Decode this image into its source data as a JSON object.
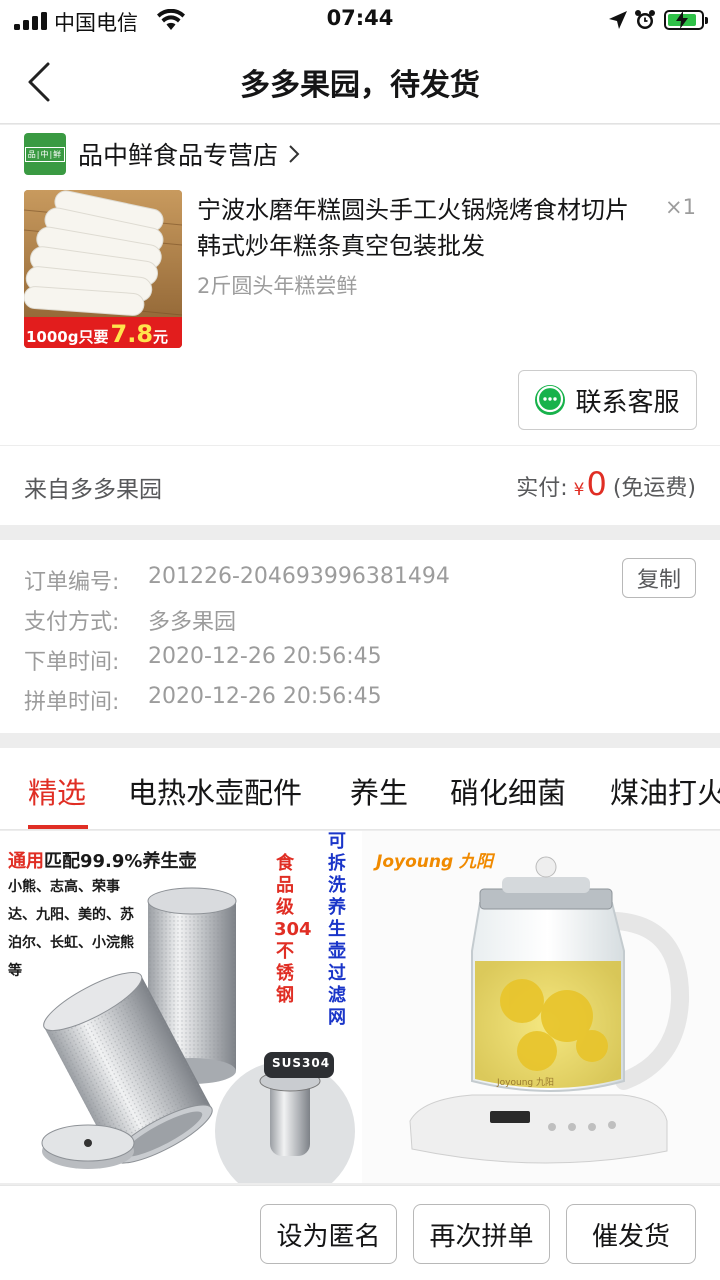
{
  "status_bar": {
    "carrier": "中国电信",
    "time": "07:44"
  },
  "nav": {
    "title": "多多果园，待发货"
  },
  "order": {
    "store": {
      "logo_text": "品|中|鲜",
      "name": "品中鲜食品专营店"
    },
    "product": {
      "title": "宁波水磨年糕圆头手工火锅烧烤食材切片韩式炒年糕条真空包装批发",
      "quantity": "×1",
      "spec": "2斤圆头年糕尝鲜",
      "image_badge_text": "1000g只要",
      "image_badge_price": "7.8",
      "image_badge_unit": "元"
    },
    "contact_label": "联系客服",
    "source": "来自多多果园",
    "payment": {
      "label": "实付:",
      "currency": "¥",
      "value": "0",
      "note": "(免运费)"
    }
  },
  "order_info": {
    "rows": [
      {
        "key": "订单编号:",
        "value": "201226-204693996381494"
      },
      {
        "key": "支付方式:",
        "value": "多多果园"
      },
      {
        "key": "下单时间:",
        "value": "2020-12-26 20:56:45"
      },
      {
        "key": "拼单时间:",
        "value": "2020-12-26 20:56:45"
      }
    ],
    "copy_label": "复制"
  },
  "recommend": {
    "tabs": [
      "精选",
      "电热水壶配件",
      "养生",
      "硝化细菌",
      "煤油打火"
    ],
    "active_tab": 0,
    "tile1": {
      "caption_red": "通用",
      "caption_black": "匹配99.9%养生壶",
      "brands": "小熊、志高、荣事达、九阳、美的、苏泊尔、长虹、小浣熊等",
      "vertical_red": "食品级304不锈钢",
      "vertical_blue": "可拆洗 养生壶过滤网",
      "steel_label": "SUS304"
    },
    "tile2": {
      "brand": "Joyoung 九阳",
      "device_brand": "Joyoung 九阳"
    }
  },
  "bottom_bar": {
    "anonymous_label": "设为匿名",
    "regroup_label": "再次拼单",
    "urge_label": "催发货"
  },
  "colors": {
    "accent": "#e02e24",
    "green": "#18b24b",
    "store_green": "#3a9a42"
  }
}
